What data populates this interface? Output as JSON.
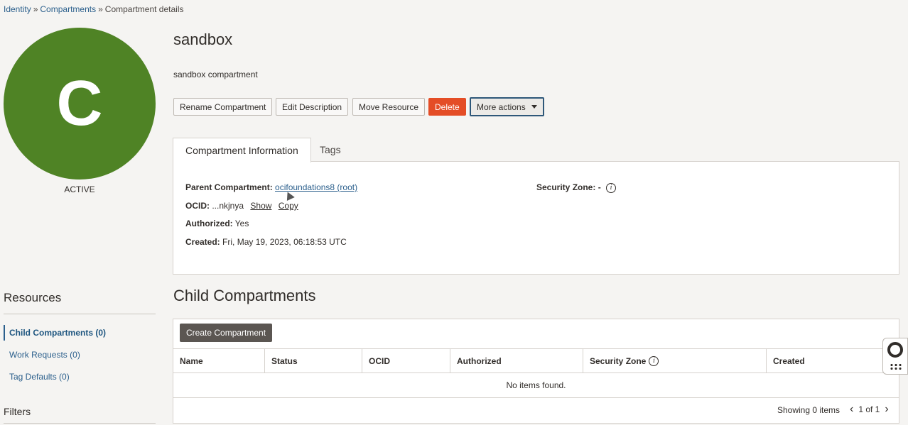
{
  "breadcrumb": {
    "items": [
      "Identity",
      "Compartments",
      "Compartment details"
    ],
    "separator": "»"
  },
  "avatar": {
    "letter": "C",
    "color": "#4f8325",
    "status": "ACTIVE"
  },
  "compartment": {
    "name": "sandbox",
    "description": "sandbox compartment"
  },
  "actions": {
    "rename": "Rename Compartment",
    "edit_description": "Edit Description",
    "move": "Move Resource",
    "delete": "Delete",
    "more": "More actions"
  },
  "tabs": [
    {
      "label": "Compartment Information",
      "active": true
    },
    {
      "label": "Tags",
      "active": false
    }
  ],
  "info": {
    "parent_label": "Parent Compartment:",
    "parent_value": "ocifoundations8 (root)",
    "ocid_label": "OCID:",
    "ocid_value": "...nkjnya",
    "ocid_show": "Show",
    "ocid_copy": "Copy",
    "authorized_label": "Authorized:",
    "authorized_value": "Yes",
    "created_label": "Created:",
    "created_value": "Fri, May 19, 2023, 06:18:53 UTC",
    "security_zone_label": "Security Zone:",
    "security_zone_value": "-"
  },
  "resources": {
    "title": "Resources",
    "items": [
      {
        "label": "Child Compartments (0)",
        "active": true
      },
      {
        "label": "Work Requests (0)",
        "active": false
      },
      {
        "label": "Tag Defaults (0)",
        "active": false
      }
    ],
    "filters_title": "Filters"
  },
  "child_compartments": {
    "title": "Child Compartments",
    "create_button": "Create Compartment",
    "columns": [
      "Name",
      "Status",
      "OCID",
      "Authorized",
      "Security Zone",
      "Created"
    ],
    "empty_text": "No items found.",
    "showing": "Showing 0 items",
    "page": "1 of 1"
  },
  "colors": {
    "accent": "#2b5f8c",
    "danger": "#e44d26",
    "avatar": "#4f8325"
  }
}
